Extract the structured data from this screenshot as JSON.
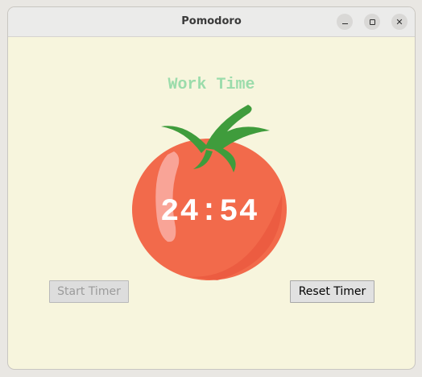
{
  "window": {
    "title": "Pomodoro",
    "controls": [
      "minimize-icon",
      "maximize-icon",
      "close-icon"
    ]
  },
  "main": {
    "heading": "Work Time",
    "timer": "24:54",
    "start_button": "Start Timer",
    "reset_button": "Reset Timer"
  },
  "colors": {
    "background": "#f7f5dd",
    "heading": "#9bdcab",
    "tomato": "#f26a4b",
    "leaf": "#3f9c3c",
    "timer_text": "#ffffff"
  }
}
